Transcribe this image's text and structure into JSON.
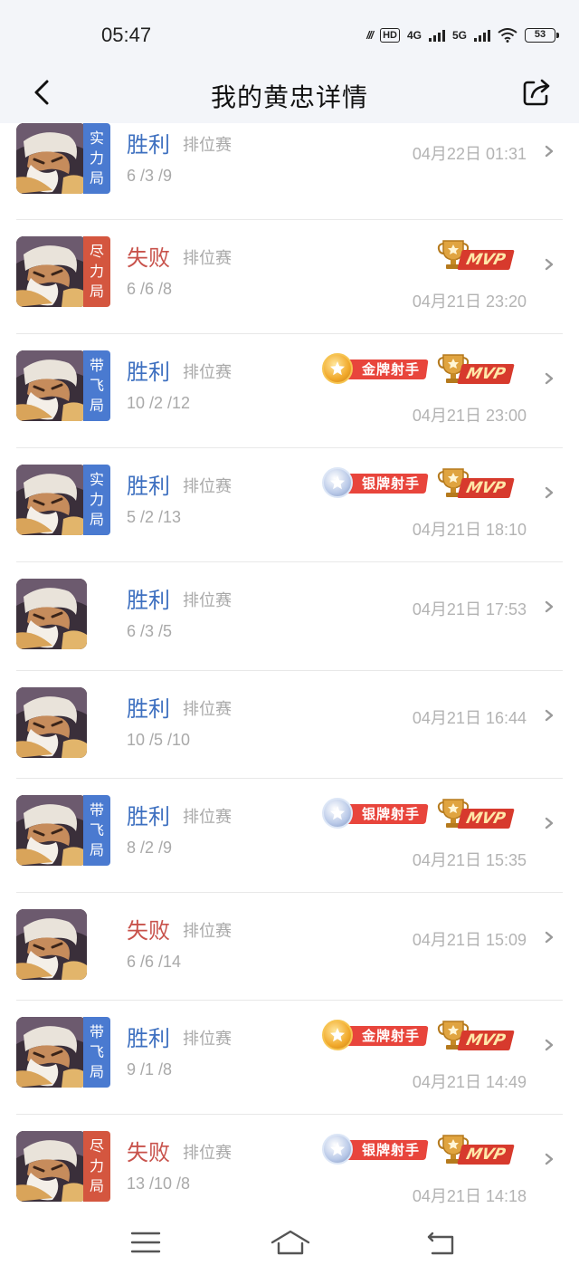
{
  "status": {
    "time": "05:47",
    "network_4g": "4G",
    "network_5g": "5G",
    "hd": "HD",
    "battery": "53"
  },
  "header": {
    "title": "我的黄忠详情"
  },
  "matches": [
    {
      "tag": "实力局",
      "tag_lines": [
        "实",
        "力",
        "局"
      ],
      "tag_color": "#4a7ad0",
      "result": "胜利",
      "mode": "排位赛",
      "kda": "6 /3 /9",
      "date": "04月22日 01:31",
      "badges": []
    },
    {
      "tag": "尽力局",
      "tag_lines": [
        "尽",
        "力",
        "局"
      ],
      "tag_color": "#d4563f",
      "result": "失败",
      "mode": "排位赛",
      "kda": "6 /6 /8",
      "date": "04月21日 23:20",
      "badges": [
        "MVP"
      ]
    },
    {
      "tag": "带飞局",
      "tag_lines": [
        "带",
        "飞",
        "局"
      ],
      "tag_color": "#4a7ad0",
      "result": "胜利",
      "mode": "排位赛",
      "kda": "10 /2 /12",
      "date": "04月21日 23:00",
      "badges": [
        "金牌射手",
        "MVP"
      ]
    },
    {
      "tag": "实力局",
      "tag_lines": [
        "实",
        "力",
        "局"
      ],
      "tag_color": "#4a7ad0",
      "result": "胜利",
      "mode": "排位赛",
      "kda": "5 /2 /13",
      "date": "04月21日 18:10",
      "badges": [
        "银牌射手",
        "MVP"
      ]
    },
    {
      "tag": "",
      "tag_lines": [],
      "result": "胜利",
      "mode": "排位赛",
      "kda": "6 /3 /5",
      "date": "04月21日 17:53",
      "badges": []
    },
    {
      "tag": "",
      "tag_lines": [],
      "result": "胜利",
      "mode": "排位赛",
      "kda": "10 /5 /10",
      "date": "04月21日 16:44",
      "badges": []
    },
    {
      "tag": "带飞局",
      "tag_lines": [
        "带",
        "飞",
        "局"
      ],
      "tag_color": "#4a7ad0",
      "result": "胜利",
      "mode": "排位赛",
      "kda": "8 /2 /9",
      "date": "04月21日 15:35",
      "badges": [
        "银牌射手",
        "MVP"
      ]
    },
    {
      "tag": "",
      "tag_lines": [],
      "result": "失败",
      "mode": "排位赛",
      "kda": "6 /6 /14",
      "date": "04月21日 15:09",
      "badges": []
    },
    {
      "tag": "带飞局",
      "tag_lines": [
        "带",
        "飞",
        "局"
      ],
      "tag_color": "#4a7ad0",
      "result": "胜利",
      "mode": "排位赛",
      "kda": "9 /1 /8",
      "date": "04月21日 14:49",
      "badges": [
        "金牌射手",
        "MVP"
      ]
    },
    {
      "tag": "尽力局",
      "tag_lines": [
        "尽",
        "力",
        "局"
      ],
      "tag_color": "#d4563f",
      "result": "失败",
      "mode": "排位赛",
      "kda": "13 /10 /8",
      "date": "04月21日 14:18",
      "badges": [
        "银牌射手",
        "MVP"
      ]
    }
  ],
  "icons": {
    "back": "chevron-left-icon",
    "share": "share-icon",
    "row_arrow": "chevron-right-icon",
    "menu": "menu-icon",
    "home": "home-icon",
    "return": "back-nav-icon"
  }
}
